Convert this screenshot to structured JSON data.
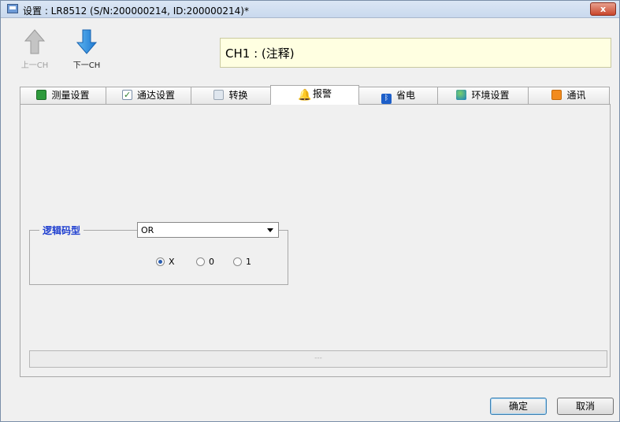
{
  "window": {
    "title": "设置 : LR8512 (S/N:200000214, ID:200000214)*",
    "close_label": "x"
  },
  "toolbar": {
    "prev_label": "上一CH",
    "next_label": "下一CH",
    "comment": "CH1 : (注释)"
  },
  "tabs": [
    {
      "label": "测量设置",
      "icon": "measure-icon"
    },
    {
      "label": "通达设置",
      "icon": "checkbox-icon"
    },
    {
      "label": "转换",
      "icon": "calculator-icon"
    },
    {
      "label": "报警",
      "icon": "bell-icon",
      "active": true
    },
    {
      "label": "省电",
      "icon": "bluetooth-icon"
    },
    {
      "label": "环境设置",
      "icon": "globe-icon"
    },
    {
      "label": "通讯",
      "icon": "rss-icon"
    }
  ],
  "logic": {
    "title": "逻辑码型",
    "selected": "OR",
    "options": [
      "X",
      "0",
      "1"
    ],
    "checked": "X"
  },
  "status_text": "---",
  "buttons": {
    "ok": "确定",
    "cancel": "取消"
  },
  "colors": {
    "accent_label": "#1f3fd0",
    "comment_bg": "#ffffe1",
    "close_button": "#c9462c"
  }
}
